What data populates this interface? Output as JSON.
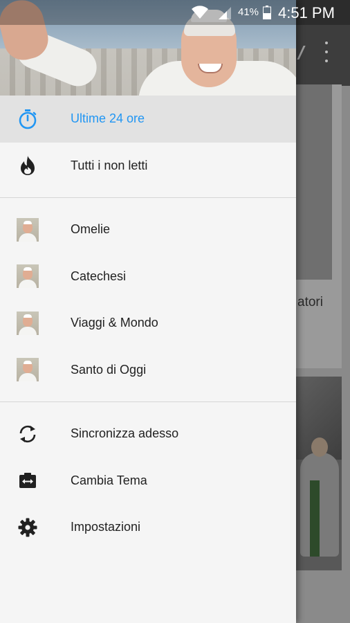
{
  "status_bar": {
    "battery_percent": "41%",
    "time": "4:51 PM"
  },
  "background": {
    "card_partial_text": "atori"
  },
  "drawer": {
    "primary_items": [
      {
        "label": "Ultime 24 ore",
        "icon": "timer-icon",
        "active": true
      },
      {
        "label": "Tutti i non letti",
        "icon": "flame-icon",
        "active": false
      }
    ],
    "category_items": [
      {
        "label": "Omelie",
        "icon": "pope-avatar-icon"
      },
      {
        "label": "Catechesi",
        "icon": "pope-avatar-icon"
      },
      {
        "label": "Viaggi & Mondo",
        "icon": "pope-avatar-icon"
      },
      {
        "label": "Santo di Oggi",
        "icon": "pope-avatar-icon"
      }
    ],
    "settings_items": [
      {
        "label": "Sincronizza adesso",
        "icon": "sync-icon"
      },
      {
        "label": "Cambia Tema",
        "icon": "theme-swap-icon"
      },
      {
        "label": "Impostazioni",
        "icon": "gear-icon"
      }
    ]
  },
  "colors": {
    "accent": "#2196f3",
    "active_bg": "#e2e2e2",
    "drawer_bg": "#f5f5f5",
    "text": "#212121"
  }
}
